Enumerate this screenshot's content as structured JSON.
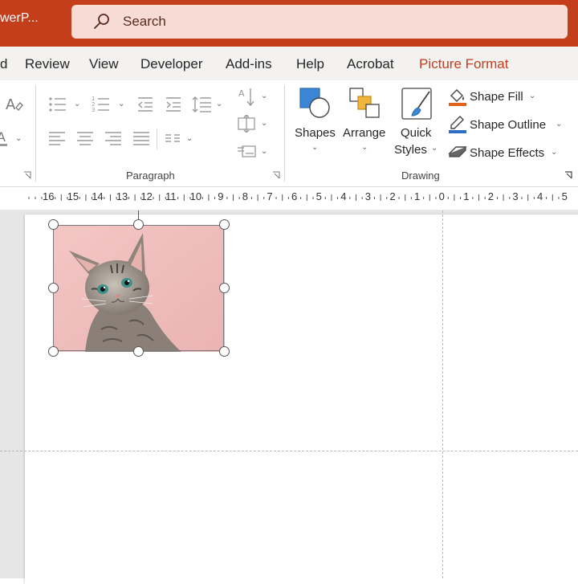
{
  "window": {
    "app_title": "werP...",
    "search_placeholder": "Search"
  },
  "tabs": [
    {
      "label": "d",
      "active": false
    },
    {
      "label": "Review",
      "active": false
    },
    {
      "label": "View",
      "active": false
    },
    {
      "label": "Developer",
      "active": false
    },
    {
      "label": "Add-ins",
      "active": false
    },
    {
      "label": "Help",
      "active": false
    },
    {
      "label": "Acrobat",
      "active": false
    },
    {
      "label": "Picture Format",
      "active": true
    }
  ],
  "ribbon": {
    "paragraph_group_label": "Paragraph",
    "drawing_group_label": "Drawing",
    "shapes_label": "Shapes",
    "arrange_label": "Arrange",
    "quick_styles_label_1": "Quick",
    "quick_styles_label_2": "Styles",
    "shape_fill_label": "Shape Fill",
    "shape_outline_label": "Shape Outline",
    "shape_effects_label": "Shape Effects"
  },
  "ruler": {
    "ticks": [
      "16",
      "15",
      "14",
      "13",
      "12",
      "11",
      "10",
      "9",
      "8",
      "7",
      "6",
      "5",
      "4",
      "3",
      "2",
      "1",
      "0",
      "1",
      "2",
      "3",
      "4",
      "5"
    ]
  },
  "colors": {
    "brand": "#c43e1c",
    "active_tab": "#c43e1c"
  },
  "slide": {
    "selected_object": "kitten-picture"
  }
}
